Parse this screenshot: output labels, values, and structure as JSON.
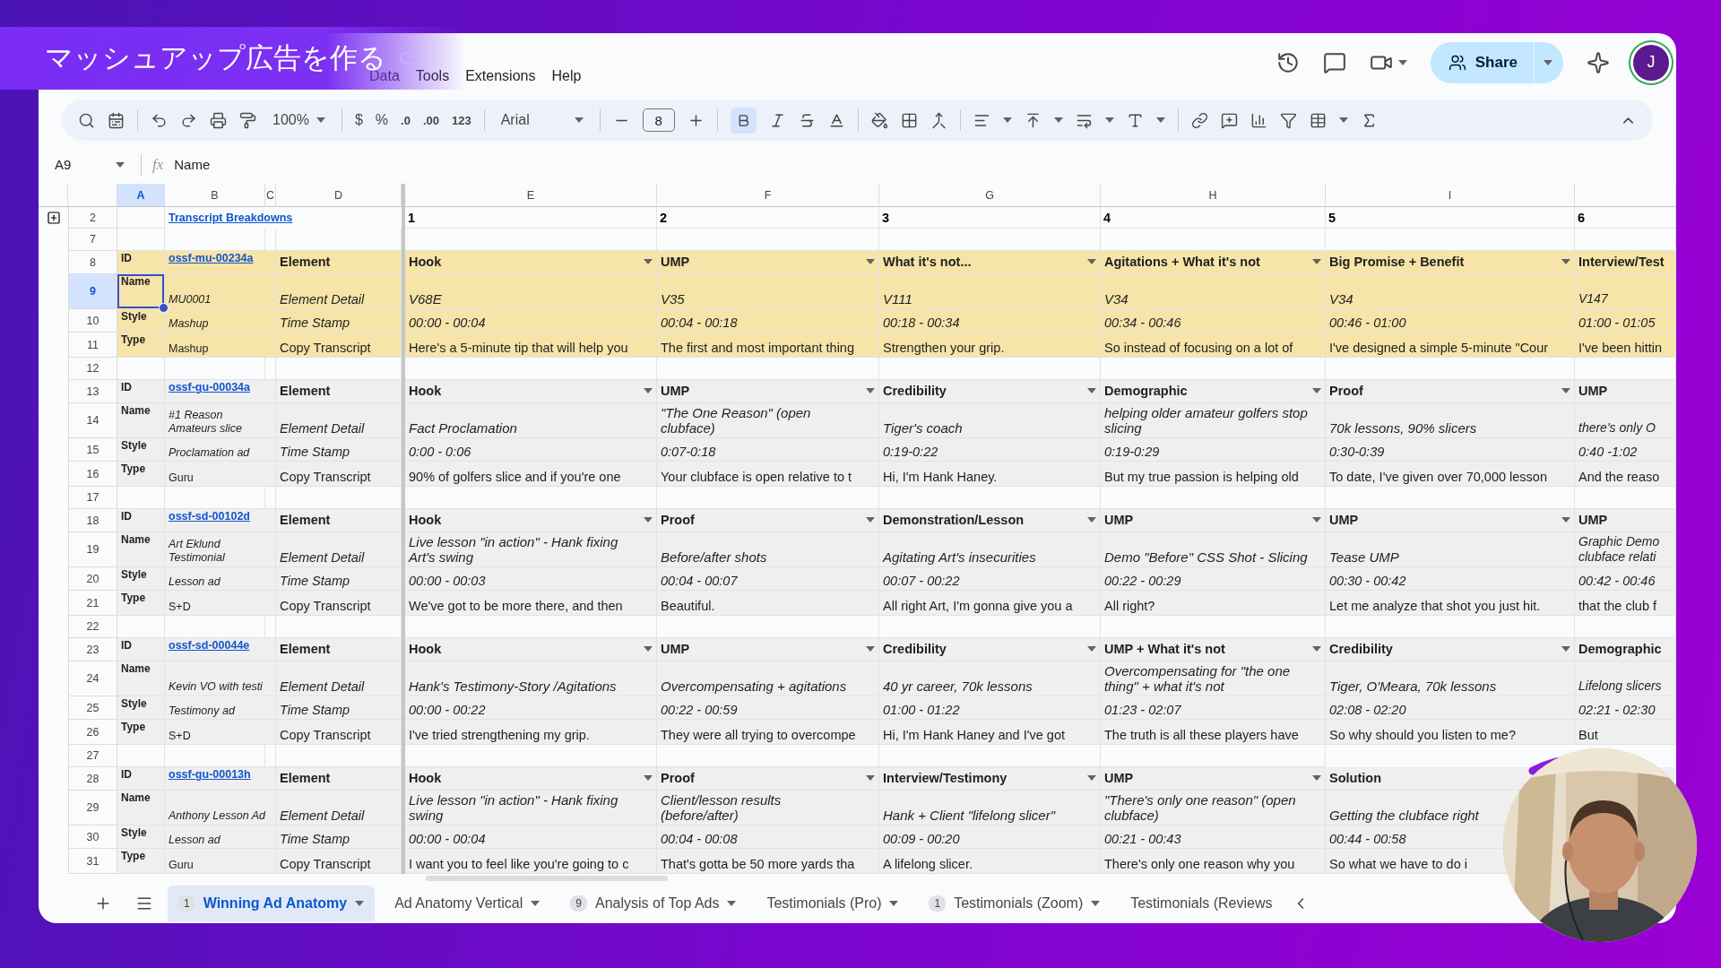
{
  "title_overlay": "マッシュアップ広告を作る",
  "menu": [
    "Data",
    "Tools",
    "Extensions",
    "Help"
  ],
  "toolbar": {
    "zoom": "100%",
    "currency": "$",
    "percent": "%",
    "decimal_less": ".0",
    "decimal_more": ".00",
    "number_format": "123",
    "font": "Arial",
    "font_size": "8",
    "bold": true
  },
  "share": "Share",
  "avatar": "J",
  "formula_bar": {
    "cell": "A9",
    "fx": "fx",
    "value": "Name"
  },
  "columns": [
    {
      "label": "A",
      "selected": true
    },
    {
      "label": "B",
      "selected": false
    },
    {
      "label": "C",
      "selected": false
    },
    {
      "label": "D",
      "selected": false
    },
    {
      "label": "E",
      "selected": false
    },
    {
      "label": "F",
      "selected": false
    },
    {
      "label": "G",
      "selected": false
    },
    {
      "label": "H",
      "selected": false
    },
    {
      "label": "I",
      "selected": false
    }
  ],
  "title_row": {
    "number": "2",
    "link": "Transcript Breakdowns",
    "numbers": [
      "1",
      "2",
      "3",
      "4",
      "5",
      "6"
    ]
  },
  "spacer_row": "7",
  "blocks": [
    {
      "color": "#f7e4a9",
      "blank_row": "12",
      "rows": [
        {
          "number": "8",
          "kind": "id",
          "label": "ID",
          "selected": false,
          "b": "ossf-mu-00234a",
          "d": "Element",
          "cells": [
            "Hook",
            "UMP",
            "What it's not...",
            "Agitations + What it's not",
            "Big Promise + Benefit",
            "Interview/Test"
          ]
        },
        {
          "number": "9",
          "kind": "name",
          "label": "Name",
          "selected": true,
          "b": "MU0001",
          "d": "Element Detail",
          "cells": [
            "V68E",
            "V35",
            "V111",
            "V34",
            "V34",
            "V147"
          ]
        },
        {
          "number": "10",
          "kind": "style",
          "label": "Style",
          "selected": false,
          "b": "Mashup",
          "d": "Time Stamp",
          "cells": [
            "00:00 - 00:04",
            "00:04 - 00:18",
            "00:18 - 00:34",
            "00:34 - 00:46",
            "00:46 - 01:00",
            "01:00 - 01:05"
          ]
        },
        {
          "number": "11",
          "kind": "type",
          "label": "Type",
          "selected": false,
          "b": "Mashup",
          "d": "Copy Transcript",
          "cells": [
            "Here's a 5-minute tip that will help you",
            "The first and most important thing",
            "Strengthen your grip.",
            "So instead of focusing on a lot of",
            "I've designed a simple 5-minute \"Cour",
            "I've been hittin"
          ]
        }
      ]
    },
    {
      "color": "#efefef",
      "blank_row": "17",
      "rows": [
        {
          "number": "13",
          "kind": "id",
          "label": "ID",
          "selected": false,
          "b": "ossf-gu-00034a",
          "d": "Element",
          "cells": [
            "Hook",
            "UMP",
            "Credibility",
            "Demographic",
            "Proof",
            "UMP"
          ]
        },
        {
          "number": "14",
          "kind": "name",
          "label": "Name",
          "selected": false,
          "b": "#1 Reason Amateurs slice",
          "d": "Element Detail",
          "cells": [
            "Fact Proclamation",
            "\"The One Reason\" (open clubface)",
            "Tiger's coach",
            "helping older amateur golfers stop slicing",
            "70k lessons, 90% slicers",
            "there's only O"
          ]
        },
        {
          "number": "15",
          "kind": "style",
          "label": "Style",
          "selected": false,
          "b": "Proclamation ad",
          "d": "Time Stamp",
          "cells": [
            "0:00 - 0:06",
            "0:07-0:18",
            "0:19-0:22",
            "0:19-0:29",
            "0:30-0:39",
            "0:40 -1:02"
          ]
        },
        {
          "number": "16",
          "kind": "type",
          "label": "Type",
          "selected": false,
          "b": "Guru",
          "d": "Copy Transcript",
          "cells": [
            "90% of golfers slice and if you're one",
            "Your clubface is open relative to t",
            "Hi, I'm Hank Haney.",
            "But my true passion is helping old",
            "To date, I've given over 70,000 lesson",
            "And the reaso"
          ]
        }
      ]
    },
    {
      "color": "#efefef",
      "blank_row": "22",
      "rows": [
        {
          "number": "18",
          "kind": "id",
          "label": "ID",
          "selected": false,
          "b": "ossf-sd-00102d",
          "d": "Element",
          "cells": [
            "Hook",
            "Proof",
            "Demonstration/Lesson",
            "UMP",
            "UMP",
            "UMP"
          ]
        },
        {
          "number": "19",
          "kind": "name",
          "label": "Name",
          "selected": false,
          "b": "Art Eklund Testimonial",
          "d": "Element Detail",
          "cells": [
            "Live lesson \"in action\" -  Hank fixing Art's swing",
            "Before/after shots",
            "Agitating Art's insecurities",
            "Demo \"Before\" CSS Shot - Slicing",
            "Tease UMP",
            "Graphic Demo clubface relati"
          ]
        },
        {
          "number": "20",
          "kind": "style",
          "label": "Style",
          "selected": false,
          "b": "Lesson ad",
          "d": "Time Stamp",
          "cells": [
            "00:00 - 00:03",
            "00:04 - 00:07",
            "00:07 - 00:22",
            "00:22 - 00:29",
            "00:30 - 00:42",
            "00:42 - 00:46"
          ]
        },
        {
          "number": "21",
          "kind": "type",
          "label": "Type",
          "selected": false,
          "b": "S+D",
          "d": "Copy Transcript",
          "cells": [
            "We've got to be more there, and then",
            "Beautiful.",
            "All right Art, I'm gonna give you a",
            "All right?",
            "Let me analyze that shot you just hit.",
            "that the club f"
          ]
        }
      ]
    },
    {
      "color": "#efefef",
      "blank_row": "27",
      "rows": [
        {
          "number": "23",
          "kind": "id",
          "label": "ID",
          "selected": false,
          "b": "ossf-sd-00044e",
          "d": "Element",
          "cells": [
            "Hook",
            "UMP",
            "Credibility",
            "UMP + What it's not",
            "Credibility",
            "Demographic"
          ]
        },
        {
          "number": "24",
          "kind": "name",
          "label": "Name",
          "selected": false,
          "b": "Kevin VO with testi",
          "d": "Element Detail",
          "cells": [
            "Hank's Testimony-Story /Agitations",
            "Overcompensating + agitations",
            "40 yr career, 70k lessons",
            "Overcompensating for \"the one thing\" + what it's not",
            "Tiger, O'Meara, 70k lessons",
            "Lifelong slicers"
          ]
        },
        {
          "number": "25",
          "kind": "style",
          "label": "Style",
          "selected": false,
          "b": "Testimony ad",
          "d": "Time Stamp",
          "cells": [
            "00:00 - 00:22",
            "00:22 - 00:59",
            "01:00 - 01:22",
            "01:23 - 02:07",
            "02:08 - 02:20",
            "02:21 - 02:30"
          ]
        },
        {
          "number": "26",
          "kind": "type",
          "label": "Type",
          "selected": false,
          "b": "S+D",
          "d": "Copy Transcript",
          "cells": [
            "I've tried strengthening my grip.",
            "They were all trying to overcompe",
            "Hi, I'm Hank Haney and I've got",
            "The truth is all these players have",
            "So why should you listen to me?",
            "But"
          ]
        }
      ]
    },
    {
      "color": "#efefef",
      "rows": [
        {
          "number": "28",
          "kind": "id",
          "label": "ID",
          "selected": false,
          "b": "ossf-gu-00013h",
          "d": "Element",
          "cells": [
            "Hook",
            "Proof",
            "Interview/Testimony",
            "UMP",
            "Solution"
          ]
        },
        {
          "number": "29",
          "kind": "name",
          "label": "Name",
          "selected": false,
          "b": "Anthony Lesson Ad",
          "d": "Element Detail",
          "cells": [
            "Live lesson \"in action\" -  Hank fixing swing",
            "Client/lesson results (before/after)",
            "Hank + Client \"lifelong slicer\"",
            "\"There's only one reason\" (open clubface)",
            "Getting the clubface right"
          ]
        },
        {
          "number": "30",
          "kind": "style",
          "label": "Style",
          "selected": false,
          "b": "Lesson ad",
          "d": "Time Stamp",
          "cells": [
            "00:00 - 00:04",
            "00:04 - 00:08",
            "00:09 - 00:20",
            "00:21 - 00:43",
            "00:44 - 00:58"
          ]
        },
        {
          "number": "31",
          "kind": "type",
          "label": "Type",
          "selected": false,
          "b": "Guru",
          "d": "Copy Transcript",
          "cells": [
            "I want you to feel like you're going to c",
            "That's gotta be 50 more yards tha",
            "A lifelong slicer.",
            "There's only one reason why you",
            "So what we have to do i"
          ]
        }
      ]
    }
  ],
  "tabs": [
    {
      "label": "Winning Ad Anatomy",
      "badge": "1",
      "selected": true
    },
    {
      "label": "Ad Anatomy Vertical",
      "selected": false
    },
    {
      "label": "Analysis of Top Ads",
      "badge": "9",
      "selected": false
    },
    {
      "label": "Testimonials (Pro)",
      "selected": false
    },
    {
      "label": "Testimonials (Zoom)",
      "badge": "1",
      "selected": false
    },
    {
      "label": "Testimonials (Reviews",
      "selected": false
    }
  ]
}
